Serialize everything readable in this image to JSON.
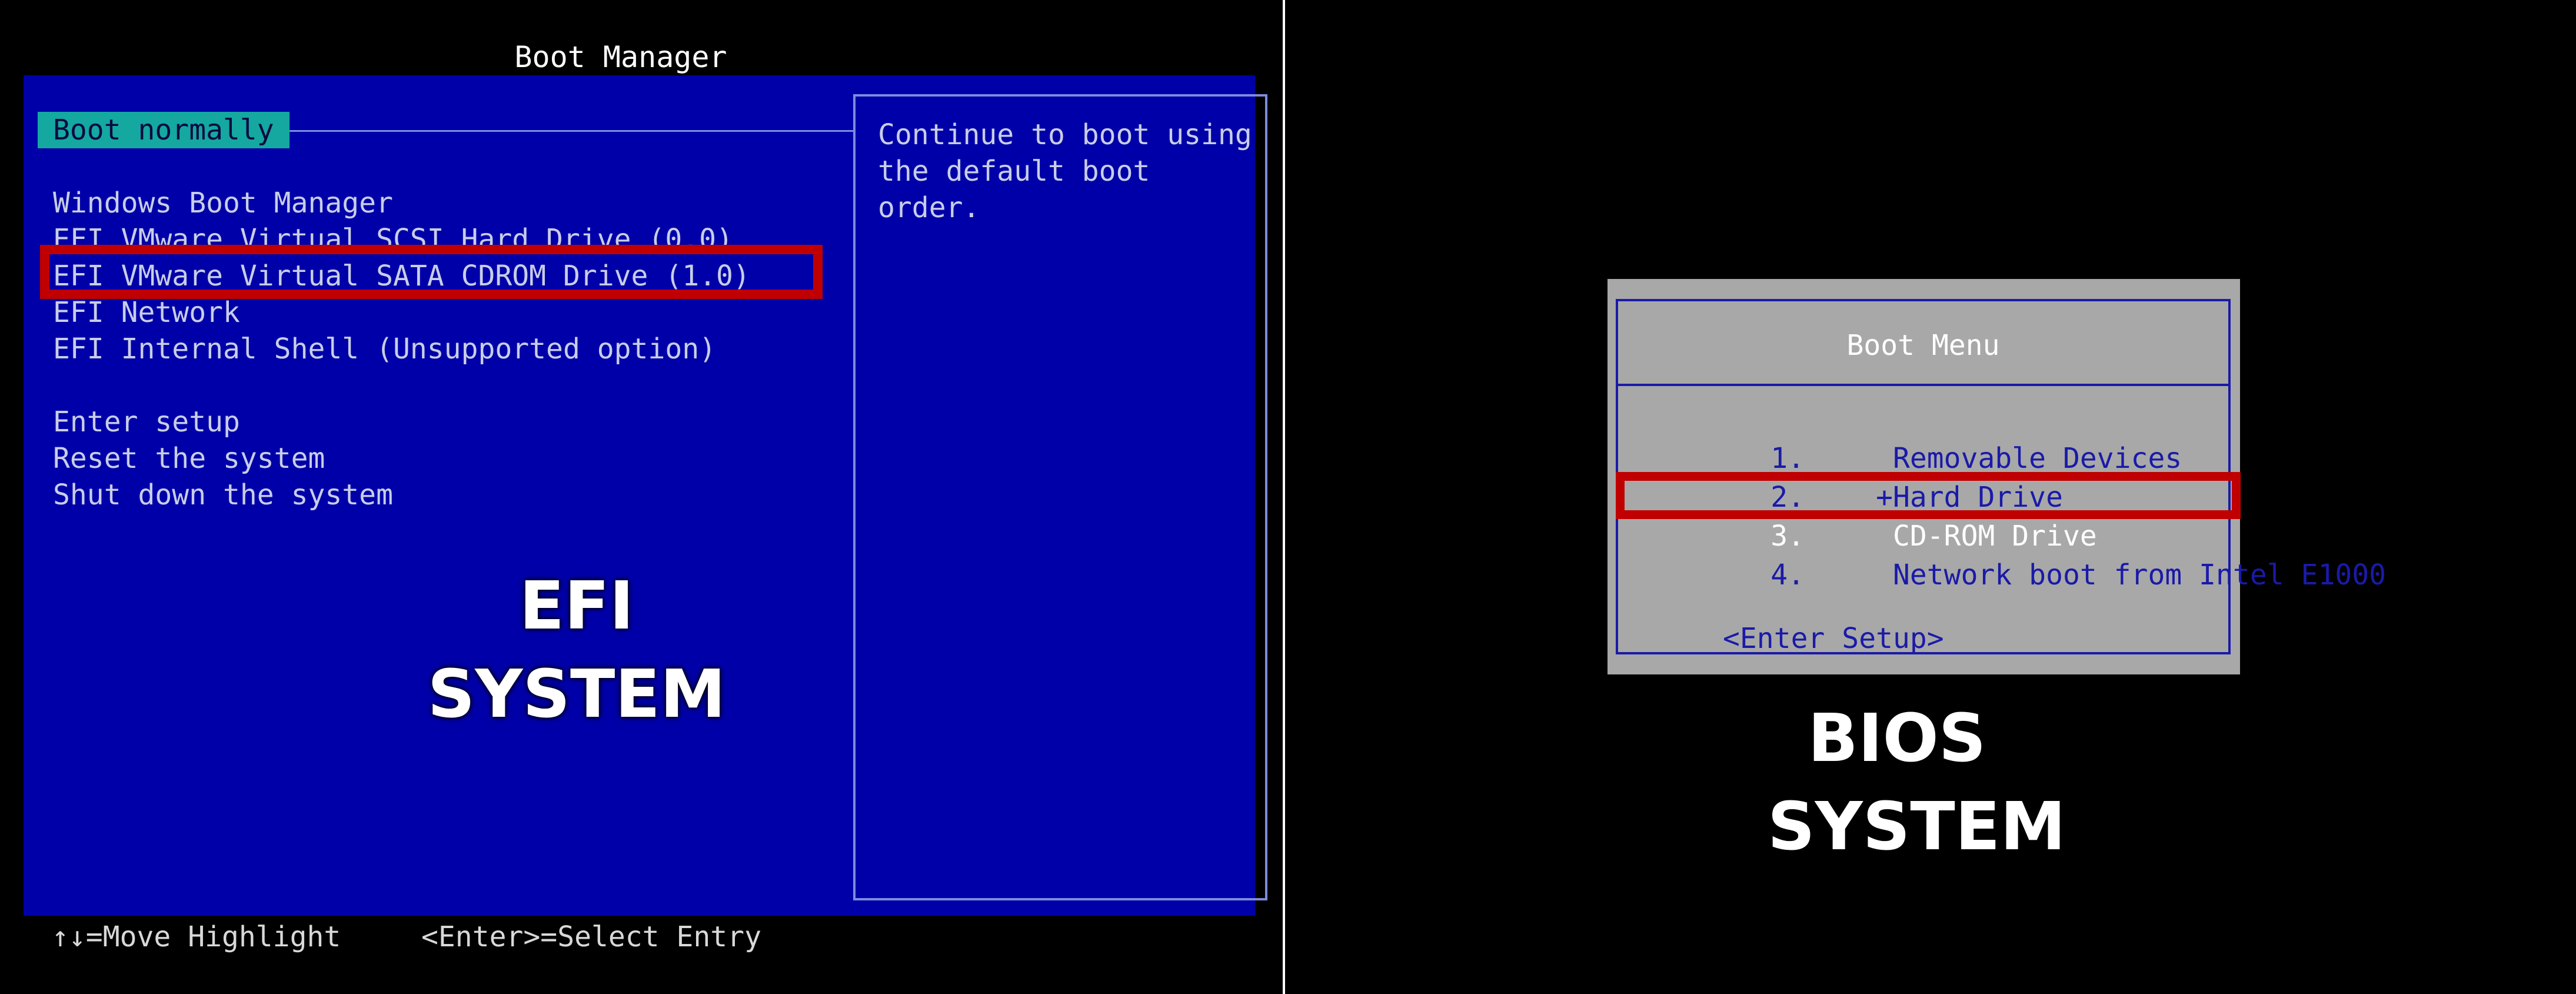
{
  "efi": {
    "title": "Boot Manager",
    "menu_items": [
      {
        "label": "Boot normally",
        "selected": true
      },
      {
        "label": "Windows Boot Manager"
      },
      {
        "label": "EFI VMware Virtual SCSI Hard Drive (0.0)"
      },
      {
        "label": "EFI VMware Virtual SATA CDROM Drive (1.0)",
        "highlighted": true
      },
      {
        "label": "EFI Network"
      },
      {
        "label": "EFI Internal Shell (Unsupported option)"
      },
      {
        "label": "Enter setup"
      },
      {
        "label": "Reset the system"
      },
      {
        "label": "Shut down the system"
      }
    ],
    "help_text": "Continue to boot using\nthe default boot order.",
    "footer_move": "↑↓=Move Highlight",
    "footer_select": "<Enter>=Select Entry",
    "caption_line1": "EFI",
    "caption_line2": "SYSTEM"
  },
  "bios": {
    "title": "Boot Menu",
    "menu_items": [
      {
        "num": "1.",
        "label": "  Removable Devices"
      },
      {
        "num": "2.",
        "label": " +Hard Drive"
      },
      {
        "num": "3.",
        "label": "  CD-ROM Drive",
        "selected": true,
        "highlighted": true
      },
      {
        "num": "4.",
        "label": "  Network boot from Intel E1000"
      }
    ],
    "setup_label": "<Enter Setup>",
    "caption_line1": "BIOS",
    "caption_line2": "SYSTEM"
  },
  "colors": {
    "efi_background": "#0000a8",
    "efi_selection": "#14a8a0",
    "bios_background": "#a8a8a8",
    "bios_text": "#1a1aa8",
    "annotation_red": "#c00000"
  }
}
